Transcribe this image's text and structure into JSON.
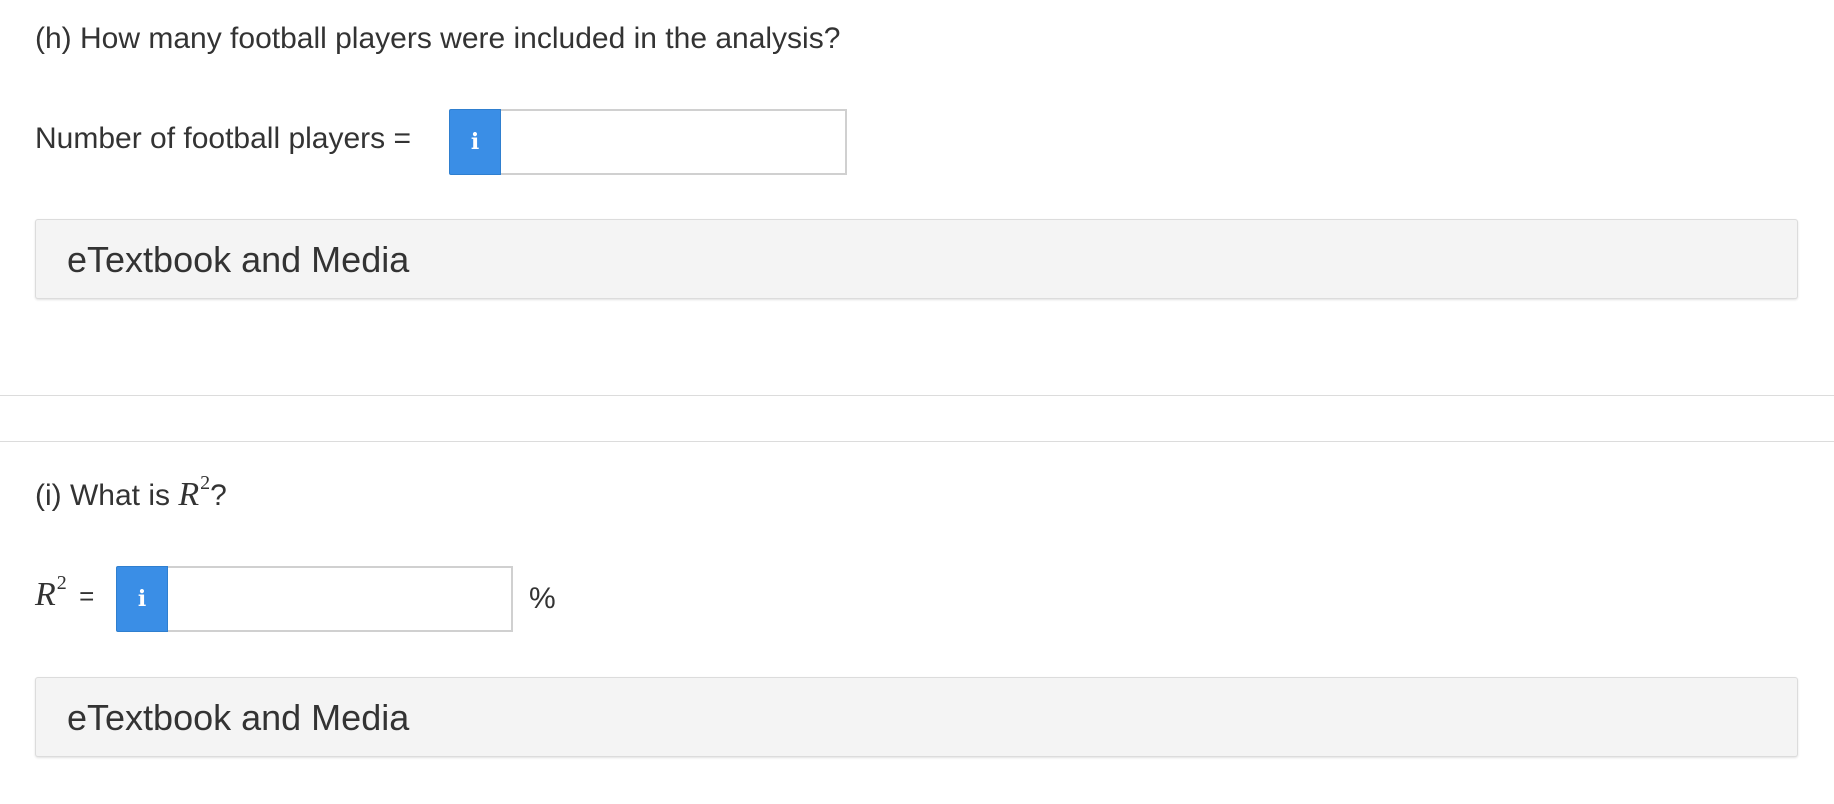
{
  "part_h": {
    "question": "(h) How many football players were included in the analysis?",
    "answer_label": "Number of football players =",
    "info_glyph": "i",
    "input_value": "",
    "media_label": "eTextbook and Media"
  },
  "part_i": {
    "question_prefix": "(i) What is ",
    "question_var": "R",
    "question_sup": "2",
    "question_suffix": "?",
    "answer_var": "R",
    "answer_sup": "2",
    "answer_equals": "=",
    "info_glyph": "i",
    "input_value": "",
    "unit": "%",
    "media_label": "eTextbook and Media"
  },
  "colors": {
    "info_button": "#3a8ee6",
    "panel_background": "#f4f4f4",
    "text": "#333333"
  }
}
